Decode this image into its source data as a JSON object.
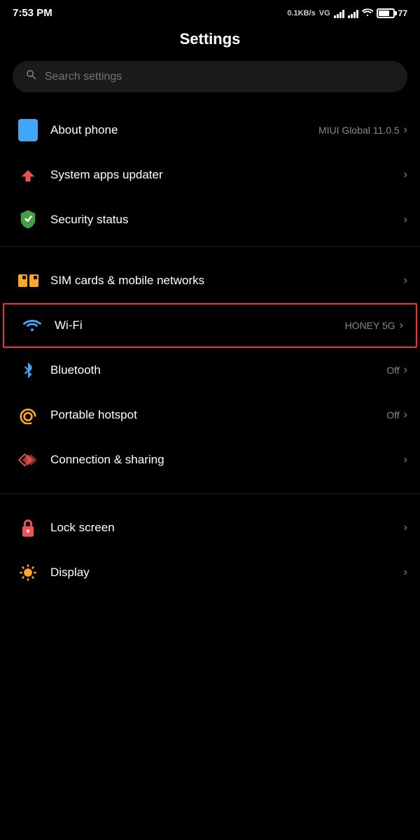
{
  "statusBar": {
    "time": "7:53 PM",
    "speed": "0.1KB/s",
    "network": "VG",
    "battery": "77"
  },
  "header": {
    "title": "Settings"
  },
  "search": {
    "placeholder": "Search settings"
  },
  "settingsGroups": [
    {
      "id": "group1",
      "items": [
        {
          "id": "about-phone",
          "label": "About phone",
          "value": "MIUI Global 11.0.5",
          "icon": "phone-icon",
          "hasChevron": true
        },
        {
          "id": "system-apps",
          "label": "System apps updater",
          "value": "",
          "icon": "arrow-up-icon",
          "hasChevron": true
        },
        {
          "id": "security-status",
          "label": "Security status",
          "value": "",
          "icon": "shield-icon",
          "hasChevron": true
        }
      ]
    },
    {
      "id": "group2",
      "items": [
        {
          "id": "sim-cards",
          "label": "SIM cards & mobile networks",
          "value": "",
          "icon": "sim-icon",
          "hasChevron": true,
          "highlighted": false
        },
        {
          "id": "wifi",
          "label": "Wi-Fi",
          "value": "HONEY 5G",
          "icon": "wifi-icon",
          "hasChevron": true,
          "highlighted": true
        },
        {
          "id": "bluetooth",
          "label": "Bluetooth",
          "value": "Off",
          "icon": "bluetooth-icon",
          "hasChevron": true
        },
        {
          "id": "hotspot",
          "label": "Portable hotspot",
          "value": "Off",
          "icon": "hotspot-icon",
          "hasChevron": true
        },
        {
          "id": "connection",
          "label": "Connection & sharing",
          "value": "",
          "icon": "connection-icon",
          "hasChevron": true
        }
      ]
    },
    {
      "id": "group3",
      "items": [
        {
          "id": "lock-screen",
          "label": "Lock screen",
          "value": "",
          "icon": "lock-icon",
          "hasChevron": true
        },
        {
          "id": "display",
          "label": "Display",
          "value": "",
          "icon": "display-icon",
          "hasChevron": true
        }
      ]
    }
  ],
  "icons": {
    "chevron": "›",
    "search": "🔍"
  }
}
